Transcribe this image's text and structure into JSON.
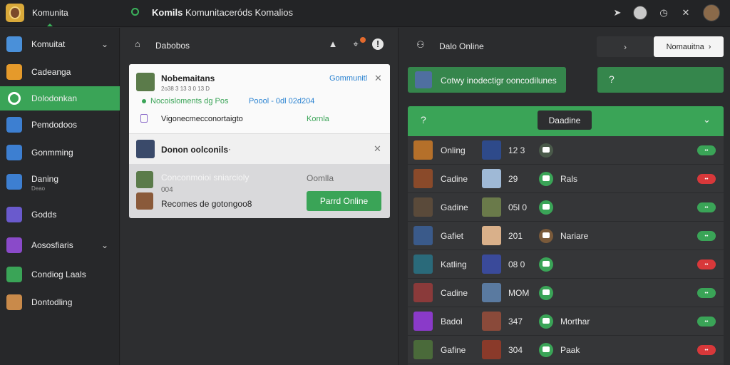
{
  "app": {
    "brand": "Komunita",
    "title_bold": "Komils",
    "title_rest": " Komunitaceróds Komalios"
  },
  "sidebar": {
    "items": [
      {
        "label": "Komuitat",
        "icon": "home-icon",
        "color": "#4a90d9",
        "chevron": true,
        "active": false
      },
      {
        "label": "Cadeanga",
        "icon": "swoosh-icon",
        "color": "#e59a2b",
        "chevron": false,
        "active": false
      },
      {
        "label": "Dolodonkan",
        "icon": "ring-icon",
        "color": "#e6e6e6",
        "chevron": false,
        "active": true
      },
      {
        "label": "Pemdodoos",
        "icon": "globe-icon",
        "color": "#3d7fd1",
        "chevron": false,
        "active": false
      },
      {
        "label": "Gonmming",
        "icon": "s-icon",
        "color": "#3d7fd1",
        "chevron": false,
        "active": false
      },
      {
        "label": "Daning",
        "sub": "Deao",
        "icon": "compass-icon",
        "color": "#3d7fd1",
        "chevron": false,
        "active": false
      },
      {
        "label": "Godds",
        "icon": "game-art-icon",
        "color": "#6a5acd",
        "chevron": false,
        "active": false
      },
      {
        "label": "Aososfiaris",
        "icon": "character-art-icon",
        "color": "#8a4ac9",
        "chevron": true,
        "active": false
      },
      {
        "label": "Condiog Laals",
        "icon": "check-icon",
        "color": "#3aa457",
        "chevron": false,
        "active": false
      },
      {
        "label": "Dontodling",
        "icon": "avatar-icon",
        "color": "#c98a4a",
        "chevron": false,
        "active": false
      }
    ]
  },
  "middle": {
    "title": "Dabobos",
    "notification": {
      "title": "Nobemaitans",
      "meta": "2o38 3 13 3 0 13 D",
      "link": "Gommunitl",
      "status_line_green": "Nocoisloments dg Pos",
      "status_line_blue": "Poool - 0dl 02d204",
      "desc": "Vigonecmecconortaigto",
      "desc_link": "Kornla"
    },
    "second_card": {
      "title": "Donon oolconils"
    },
    "third_card": {
      "title": "Conconmoioi sniarcioly",
      "sub": "004",
      "body": "Recomes de gotongoo8",
      "right_label": "Oomlla",
      "button": "Parrd Online"
    }
  },
  "right": {
    "title": "Dalo Online",
    "box_chevron": "›",
    "button": "Nomauitna",
    "green_label": "Cotwy inodectigr ooncodilunes",
    "green2_label": "?",
    "table_head_q": "?",
    "table_head_pill": "Daadine",
    "rows": [
      {
        "name": "Onling",
        "num": "12 3",
        "label": "",
        "status": "green",
        "av": "#b5702a",
        "av2": "#2e4a8a",
        "chat": false,
        "chat_color": "#4a5a4a"
      },
      {
        "name": "Cadine",
        "num": "29",
        "label": "Rals",
        "status": "red",
        "av": "#8a4a2a",
        "av2": "#9fb9d6",
        "chat": true,
        "chat_color": "#3aa457"
      },
      {
        "name": "Gadine",
        "num": "05l 0",
        "label": "",
        "status": "green",
        "av": "#5a4a3a",
        "av2": "#6a7a4a",
        "chat": true,
        "chat_color": "#3aa457"
      },
      {
        "name": "Gafiet",
        "num": "201",
        "label": "Nariare",
        "status": "green",
        "av": "#3a5a8a",
        "av2": "#d9b08a",
        "chat": false,
        "chat_color": "#7a5a3a"
      },
      {
        "name": "Katling",
        "num": "08 0",
        "label": "",
        "status": "red",
        "av": "#2a6a7a",
        "av2": "#3a4a9a",
        "chat": true,
        "chat_color": "#3aa457"
      },
      {
        "name": "Cadine",
        "num": "MOM",
        "label": "",
        "status": "green",
        "av": "#8a3a3a",
        "av2": "#5a7aa0",
        "chat": true,
        "chat_color": "#3aa457"
      },
      {
        "name": "Badol",
        "num": "347",
        "label": "Morthar",
        "status": "green",
        "av": "#8a3ac9",
        "av2": "#8a4a3a",
        "chat": false,
        "chat_color": "#3aa457"
      },
      {
        "name": "Gafine",
        "num": "304",
        "label": "Paak",
        "status": "red",
        "av": "#4a6a3a",
        "av2": "#8a3a2a",
        "chat": true,
        "chat_color": "#3aa457"
      }
    ]
  }
}
